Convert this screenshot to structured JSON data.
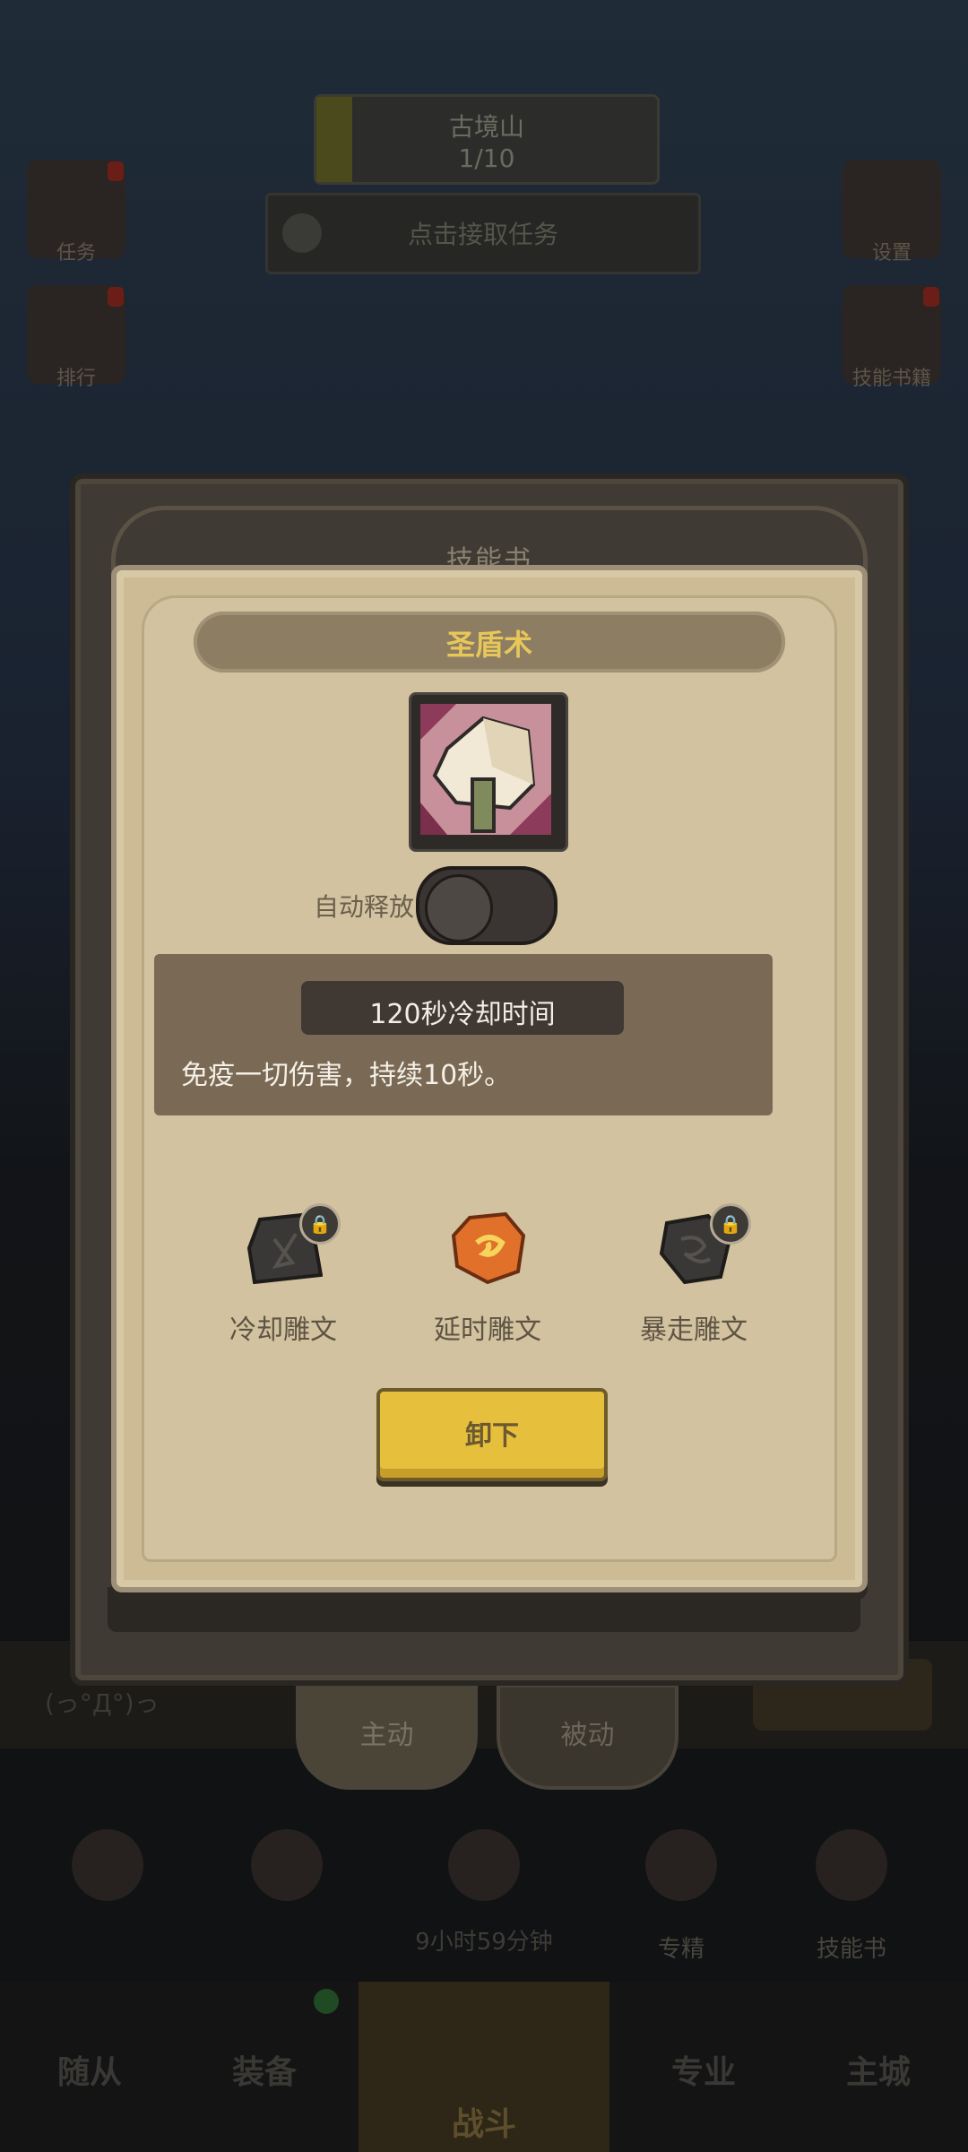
{
  "background": {
    "region_name": "古境山",
    "region_progress": "1/10",
    "quest_prompt": "点击接取任务",
    "side_left": [
      "任务",
      "排行"
    ],
    "side_right": [
      "设置",
      "技能书籍"
    ],
    "tabs": [
      {
        "label": "主动"
      },
      {
        "label": "被动"
      }
    ],
    "tools": [
      {
        "label": ""
      },
      {
        "label": ""
      },
      {
        "label": ""
      },
      {
        "label": "专精"
      },
      {
        "label": "技能书"
      }
    ],
    "timer": "9小时59分钟",
    "nav": [
      {
        "label": "随从"
      },
      {
        "label": "装备"
      },
      {
        "label": "战斗"
      },
      {
        "label": "专业"
      },
      {
        "label": "主城"
      }
    ],
    "strip_left": "(っ°Д°)っ"
  },
  "outer_title": "技能书",
  "dialog": {
    "skill_name": "圣盾术",
    "skill_icon": "shield-icon",
    "auto_cast_label": "自动释放",
    "auto_cast_enabled": false,
    "cooldown": "120秒冷却时间",
    "description": "免疫一切伤害，持续10秒。",
    "runes": [
      {
        "label": "冷却雕文",
        "icon": "rune-cooldown-icon",
        "locked": true,
        "color": "#3a3836"
      },
      {
        "label": "延时雕文",
        "icon": "rune-delay-icon",
        "locked": false,
        "color": "#e0702a"
      },
      {
        "label": "暴走雕文",
        "icon": "rune-rampage-icon",
        "locked": true,
        "color": "#3a3836"
      }
    ],
    "unequip_label": "卸下"
  },
  "colors": {
    "title_gold": "#e8c75a",
    "parchment": "#d2c29f",
    "button_yellow": "#e6bf3c"
  }
}
